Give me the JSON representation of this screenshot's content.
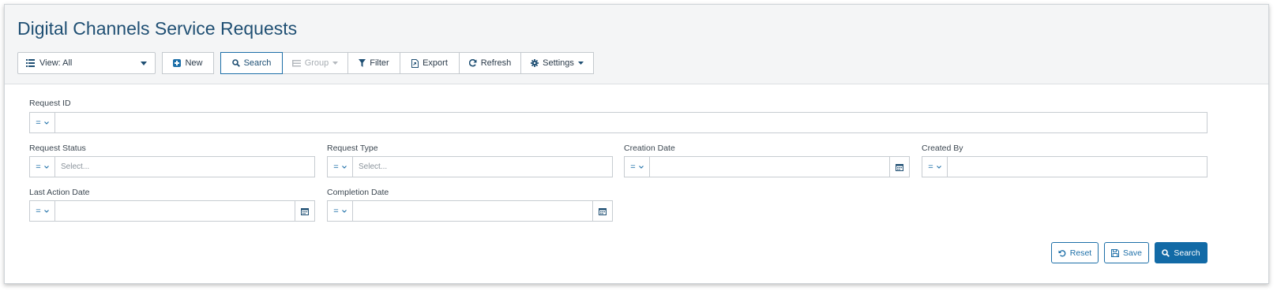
{
  "page": {
    "title": "Digital Channels Service Requests"
  },
  "toolbar": {
    "view_label": "View: All",
    "new_label": "New",
    "search_label": "Search",
    "group_label": "Group",
    "filter_label": "Filter",
    "export_label": "Export",
    "refresh_label": "Refresh",
    "settings_label": "Settings"
  },
  "form": {
    "request_id": {
      "label": "Request ID",
      "operator": "=",
      "value": ""
    },
    "request_status": {
      "label": "Request Status",
      "operator": "=",
      "placeholder": "Select..."
    },
    "request_type": {
      "label": "Request Type",
      "operator": "=",
      "placeholder": "Select..."
    },
    "creation_date": {
      "label": "Creation Date",
      "operator": "=",
      "value": ""
    },
    "created_by": {
      "label": "Created By",
      "operator": "=",
      "value": ""
    },
    "last_action_date": {
      "label": "Last Action Date",
      "operator": "=",
      "value": ""
    },
    "completion_date": {
      "label": "Completion Date",
      "operator": "=",
      "value": ""
    }
  },
  "actions": {
    "reset_label": "Reset",
    "save_label": "Save",
    "search_label": "Search"
  },
  "colors": {
    "accent": "#1d6fa8",
    "title": "#1f4f73",
    "primary_button": "#126aa6",
    "header_bg": "#f4f5f6"
  },
  "icons": {
    "view": "list-icon",
    "new": "plus-square-icon",
    "search": "search-icon",
    "group": "group-list-icon",
    "filter": "filter-icon",
    "export": "export-icon",
    "refresh": "refresh-icon",
    "settings": "gear-icon",
    "calendar": "calendar-icon",
    "reset": "undo-icon",
    "save": "floppy-icon"
  }
}
